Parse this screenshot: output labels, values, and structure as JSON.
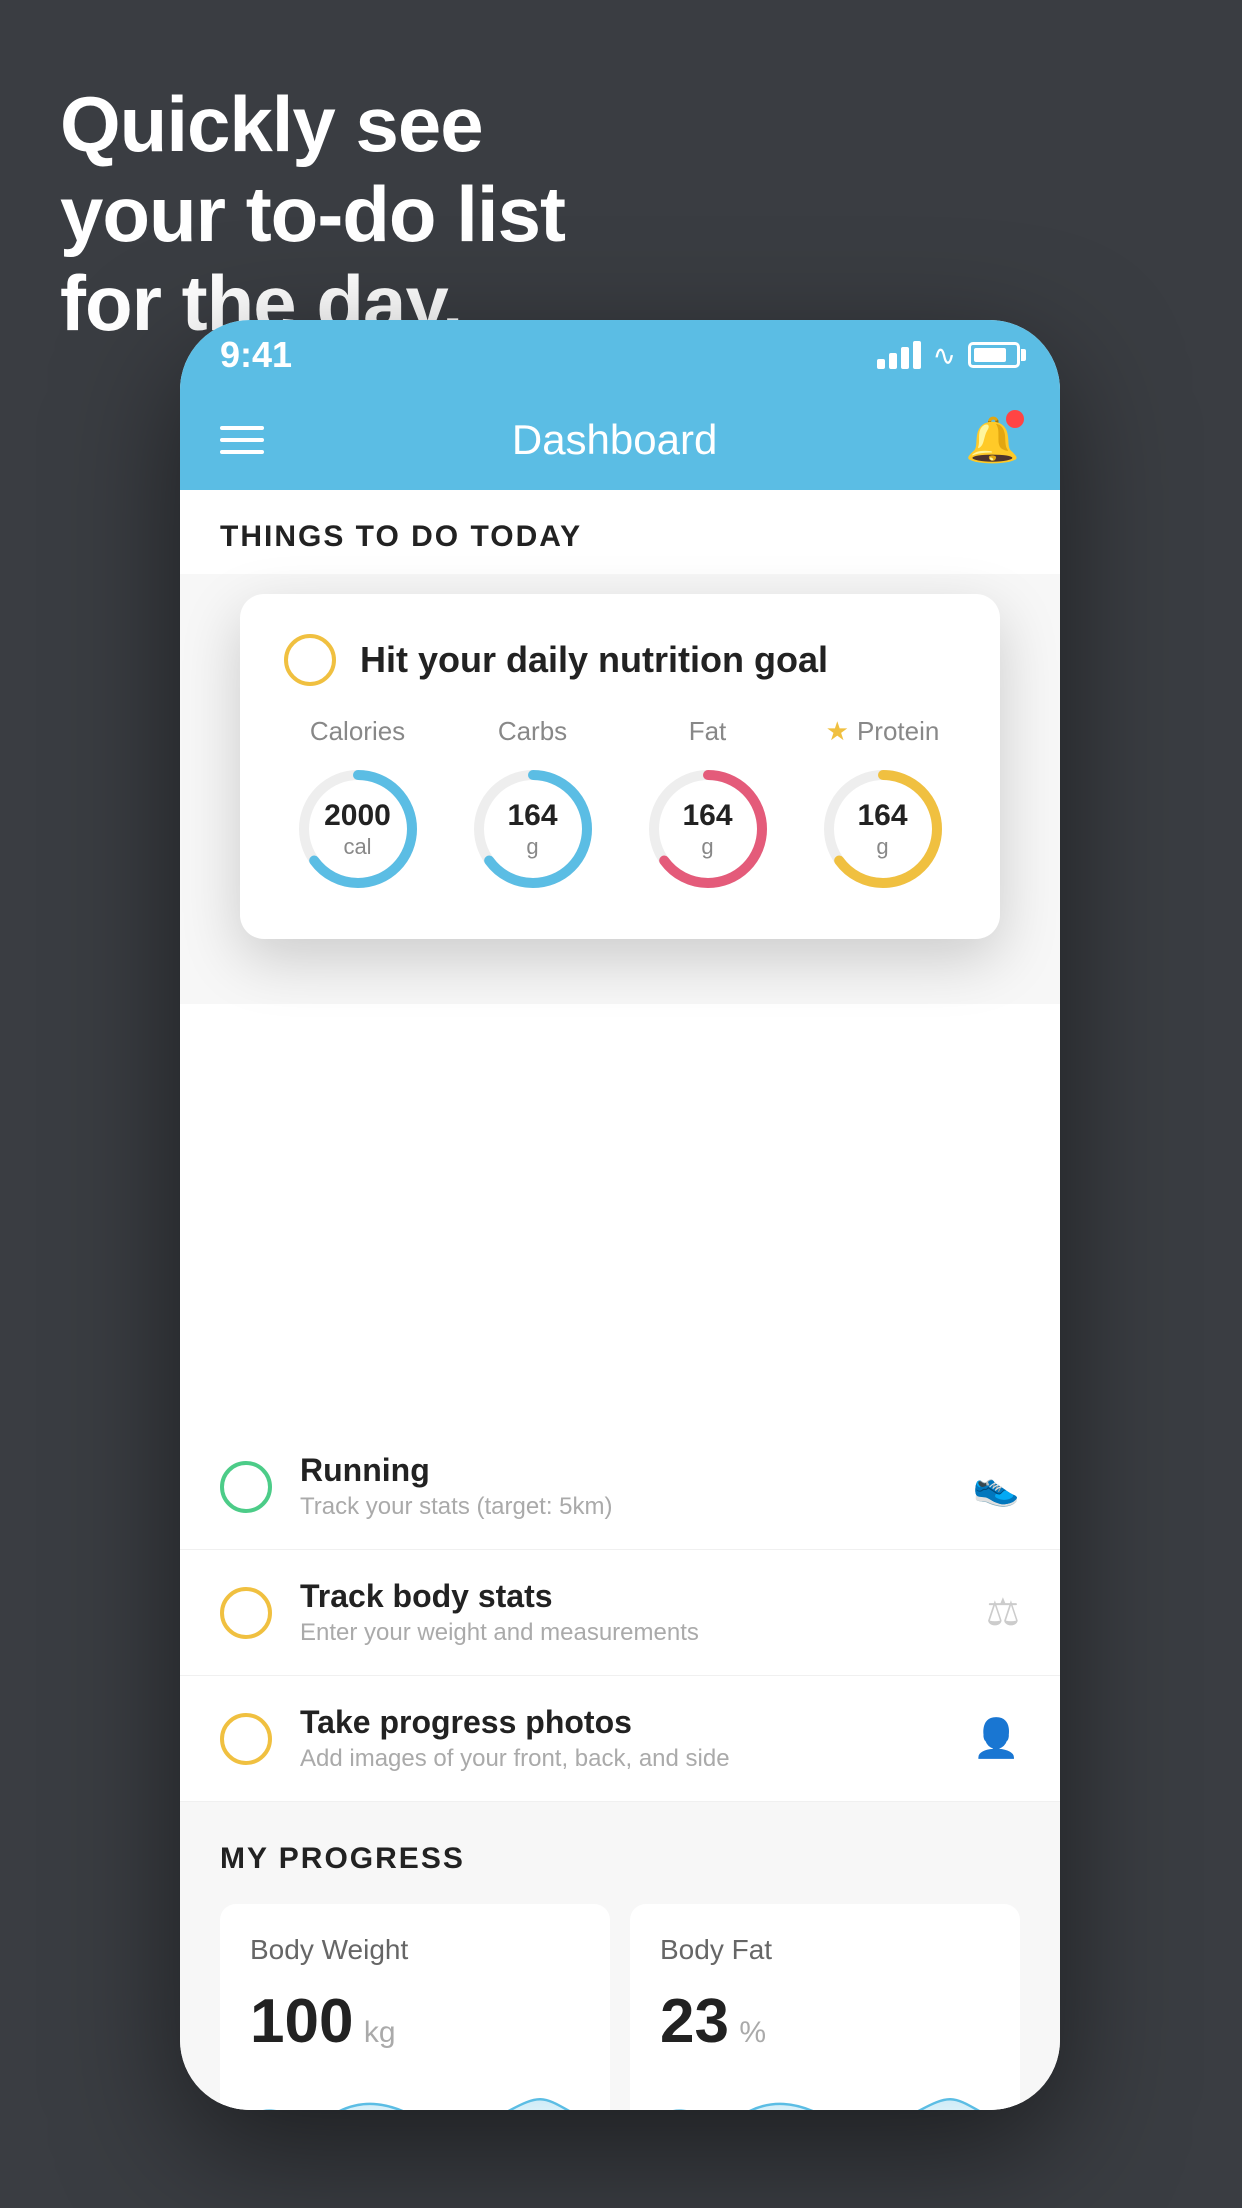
{
  "headline": {
    "line1": "Quickly see",
    "line2": "your to-do list",
    "line3": "for the day."
  },
  "status_bar": {
    "time": "9:41",
    "signal_alt": "signal",
    "wifi_alt": "wifi",
    "battery_alt": "battery"
  },
  "nav": {
    "title": "Dashboard",
    "menu_label": "menu",
    "bell_label": "notifications"
  },
  "things_section": {
    "title": "THINGS TO DO TODAY"
  },
  "nutrition_card": {
    "main_title": "Hit your daily nutrition goal",
    "items": [
      {
        "label": "Calories",
        "value": "2000",
        "unit": "cal",
        "color": "#5bbde4",
        "starred": false
      },
      {
        "label": "Carbs",
        "value": "164",
        "unit": "g",
        "color": "#5bbde4",
        "starred": false
      },
      {
        "label": "Fat",
        "value": "164",
        "unit": "g",
        "color": "#e45b7a",
        "starred": false
      },
      {
        "label": "Protein",
        "value": "164",
        "unit": "g",
        "color": "#f0c040",
        "starred": true
      }
    ]
  },
  "todo_items": [
    {
      "title": "Running",
      "subtitle": "Track your stats (target: 5km)",
      "icon": "shoe",
      "circle_color": "green",
      "checked": true
    },
    {
      "title": "Track body stats",
      "subtitle": "Enter your weight and measurements",
      "icon": "scale",
      "circle_color": "yellow",
      "checked": false
    },
    {
      "title": "Take progress photos",
      "subtitle": "Add images of your front, back, and side",
      "icon": "person",
      "circle_color": "yellow",
      "checked": false
    }
  ],
  "progress_section": {
    "title": "MY PROGRESS",
    "cards": [
      {
        "title": "Body Weight",
        "value": "100",
        "unit": "kg"
      },
      {
        "title": "Body Fat",
        "value": "23",
        "unit": "%"
      }
    ]
  }
}
